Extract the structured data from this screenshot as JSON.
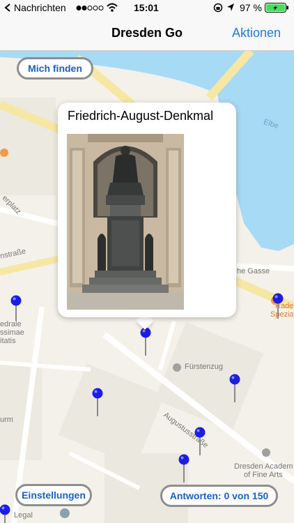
{
  "status_bar": {
    "back_app": "Nachrichten",
    "signal_icon": "signal-dots-icon",
    "wifi_icon": "wifi-icon",
    "time": "15:01",
    "battery_percent": "97 %"
  },
  "nav": {
    "title": "Dresden Go",
    "action": "Aktionen"
  },
  "map": {
    "labels": {
      "elbe": "Elbe",
      "platz": "erplatz",
      "strasse": "nstraße",
      "gasse": "he Gasse",
      "radeberger": "Radeb",
      "spezial": "Spezialau",
      "kathedrale1": "edrale",
      "kathedrale2": "ssimae",
      "kathedrale3": "itatis",
      "fuerstenzug": "Fürstenzug",
      "augustus": "Augustusstraße",
      "urm": "urm",
      "academy1": "Dresden Academ",
      "academy2": "of Fine Arts",
      "legal": "Legal"
    },
    "callout": {
      "title": "Friedrich-August-Denkmal"
    },
    "buttons": {
      "find_me": "Mich finden",
      "settings": "Einstellungen",
      "answers": "Antworten: 0 von 150"
    },
    "colors": {
      "water": "#a6daf5",
      "road_major": "#f6e7a5",
      "pin": "#1d1de8",
      "button_text": "#1a60c9"
    }
  }
}
